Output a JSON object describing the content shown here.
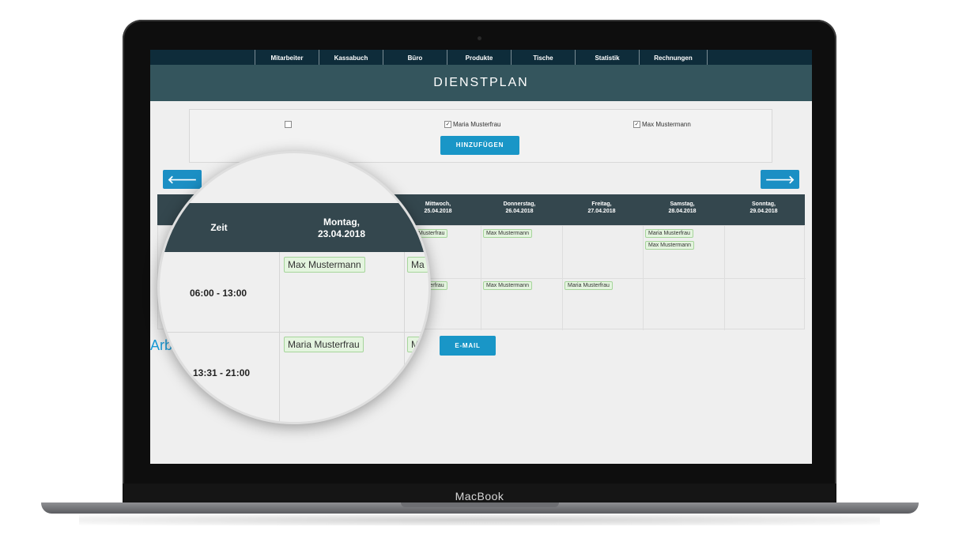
{
  "device": {
    "brand": "MacBook"
  },
  "nav": [
    "Mitarbeiter",
    "Kassabuch",
    "Büro",
    "Produkte",
    "Tische",
    "Statistik",
    "Rechnungen"
  ],
  "page_title": "DIENSTPLAN",
  "picker": {
    "employees": [
      {
        "name": "",
        "checked": false
      },
      {
        "name": "Maria Musterfrau",
        "checked": true
      },
      {
        "name": "Max Mustermann",
        "checked": true
      }
    ],
    "add_button": "HINZUFÜGEN"
  },
  "nav_arrows": {
    "prev": "🡐",
    "next": "🡒"
  },
  "table": {
    "time_header": "Zeit",
    "days": [
      {
        "name": "Montag,",
        "date": "23.04.2018"
      },
      {
        "name": "Mittwoch,",
        "date": "25.04.2018"
      },
      {
        "name": "Donnerstag,",
        "date": "26.04.2018"
      },
      {
        "name": "Freitag,",
        "date": "27.04.2018"
      },
      {
        "name": "Samstag,",
        "date": "28.04.2018"
      },
      {
        "name": "Sonntag,",
        "date": "29.04.2018"
      }
    ],
    "shifts": [
      {
        "time": "06:00 - 13:00"
      },
      {
        "time": "13:31 - 21:00"
      }
    ],
    "cells": {
      "row1_wed": "Musterfrau",
      "row1_thu": "Max Mustermann",
      "row1_sat_1": "Maria Musterfrau",
      "row1_sat_2": "Max Mustermann",
      "row2_wed": "usterfrau",
      "row2_thu": "Max Mustermann",
      "row2_fri": "Maria Musterfrau"
    },
    "lens_cells": {
      "mon_shift1": "Max Mustermann",
      "mon_shift2": "Maria Musterfrau",
      "tue_shift1_partial": "Ma",
      "tue_shift2_partial": "M"
    }
  },
  "footer": {
    "heading_partial": "Arb",
    "email_button": "E-MAIL"
  }
}
